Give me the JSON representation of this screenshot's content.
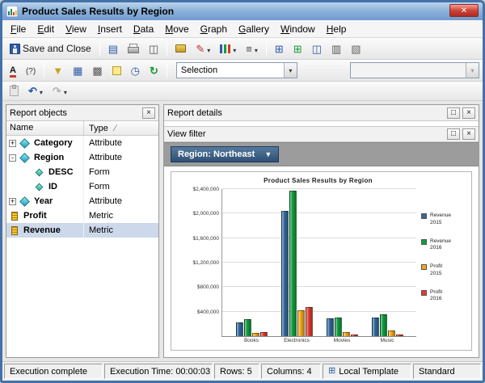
{
  "window": {
    "title": "Product Sales Results by Region"
  },
  "menu": {
    "items": [
      "File",
      "Edit",
      "View",
      "Insert",
      "Data",
      "Move",
      "Graph",
      "Gallery",
      "Window",
      "Help"
    ]
  },
  "toolbars": {
    "save_and_close": "Save and Close",
    "selection_combo": "Selection"
  },
  "report_objects": {
    "title": "Report objects",
    "columns": [
      "Name",
      "Type"
    ],
    "rows": [
      {
        "expand": "+",
        "icon": "attribute",
        "indent": 0,
        "name": "Category",
        "type": "Attribute",
        "selected": false
      },
      {
        "expand": "-",
        "icon": "attribute",
        "indent": 0,
        "name": "Region",
        "type": "Attribute",
        "selected": false
      },
      {
        "expand": "",
        "icon": "form",
        "indent": 1,
        "name": "DESC",
        "type": "Form",
        "selected": false
      },
      {
        "expand": "",
        "icon": "form",
        "indent": 1,
        "name": "ID",
        "type": "Form",
        "selected": false
      },
      {
        "expand": "+",
        "icon": "attribute",
        "indent": 0,
        "name": "Year",
        "type": "Attribute",
        "selected": false
      },
      {
        "expand": "",
        "icon": "metric",
        "indent": 0,
        "name": "Profit",
        "type": "Metric",
        "selected": false
      },
      {
        "expand": "",
        "icon": "metric",
        "indent": 0,
        "name": "Revenue",
        "type": "Metric",
        "selected": true
      }
    ]
  },
  "sections": {
    "report_details": "Report details",
    "view_filter": "View filter"
  },
  "filter": {
    "region_button": "Region: Northeast"
  },
  "chart_data": {
    "type": "bar",
    "title": "Product Sales Results by Region",
    "categories": [
      "Books",
      "Electronics",
      "Movies",
      "Music"
    ],
    "series": [
      {
        "name": "Revenue",
        "year": "2015",
        "color": "#31689b",
        "values": [
          230000,
          2050000,
          290000,
          310000
        ]
      },
      {
        "name": "Revenue",
        "year": "2016",
        "color": "#0f9d3c",
        "values": [
          280000,
          2380000,
          310000,
          360000
        ]
      },
      {
        "name": "Profit",
        "year": "2015",
        "color": "#f2a71b",
        "values": [
          50000,
          420000,
          60000,
          90000
        ]
      },
      {
        "name": "Profit",
        "year": "2016",
        "color": "#e03c31",
        "values": [
          60000,
          470000,
          30000,
          30000
        ]
      }
    ],
    "ylim": [
      0,
      2400000
    ],
    "ytick_step": 400000,
    "ytick_labels": [
      "$400,000",
      "$800,000",
      "$1,200,000",
      "$1,600,000",
      "$2,000,000",
      "$2,400,000"
    ],
    "legend_position": "right",
    "grid": true
  },
  "status_bar": {
    "items": [
      {
        "text": "Execution complete"
      },
      {
        "text": "Execution Time: 00:00:03"
      },
      {
        "text": "Rows: 5"
      },
      {
        "text": "Columns: 4"
      },
      {
        "text": "Local Template",
        "icon": "local-template-icon"
      },
      {
        "text": "Standard"
      }
    ]
  }
}
